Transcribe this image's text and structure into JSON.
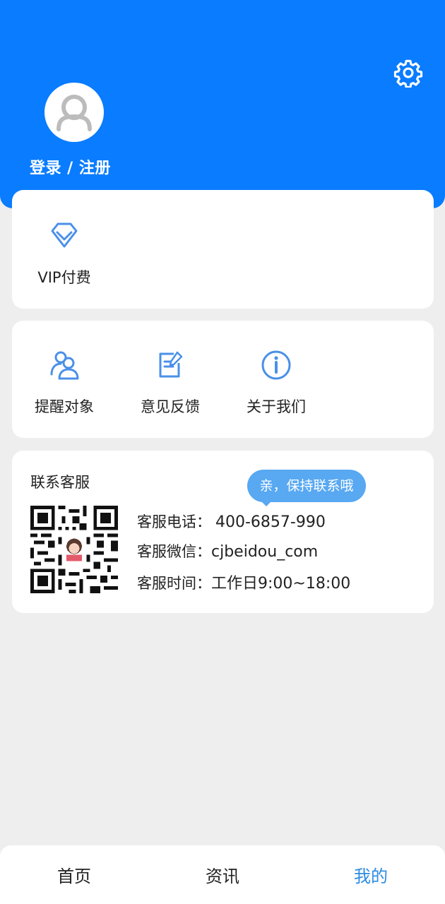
{
  "header": {
    "login_label": "登录 / 注册",
    "settings_icon": "gear-icon",
    "avatar_icon": "user-avatar-icon",
    "background_color": "#0a7cff"
  },
  "vip": {
    "label": "VIP付费",
    "icon": "diamond-icon"
  },
  "tools": [
    {
      "label": "提醒对象",
      "icon": "users-icon"
    },
    {
      "label": "意见反馈",
      "icon": "edit-note-icon"
    },
    {
      "label": "关于我们",
      "icon": "info-icon"
    }
  ],
  "service": {
    "title": "联系客服",
    "bubble": "亲，保持联系哦",
    "phone_label": "客服电话：",
    "phone_value": "400-6857-990",
    "wechat_label": "客服微信：",
    "wechat_value": "cjbeidou_com",
    "hours_label": "客服时间：",
    "hours_value": "工作日9:00~18:00",
    "qr_icon": "qr-code-icon"
  },
  "tabbar": {
    "items": [
      {
        "label": "首页",
        "active": false
      },
      {
        "label": "资讯",
        "active": false
      },
      {
        "label": "我的",
        "active": true
      }
    ],
    "active_color": "#2d8ce0"
  }
}
